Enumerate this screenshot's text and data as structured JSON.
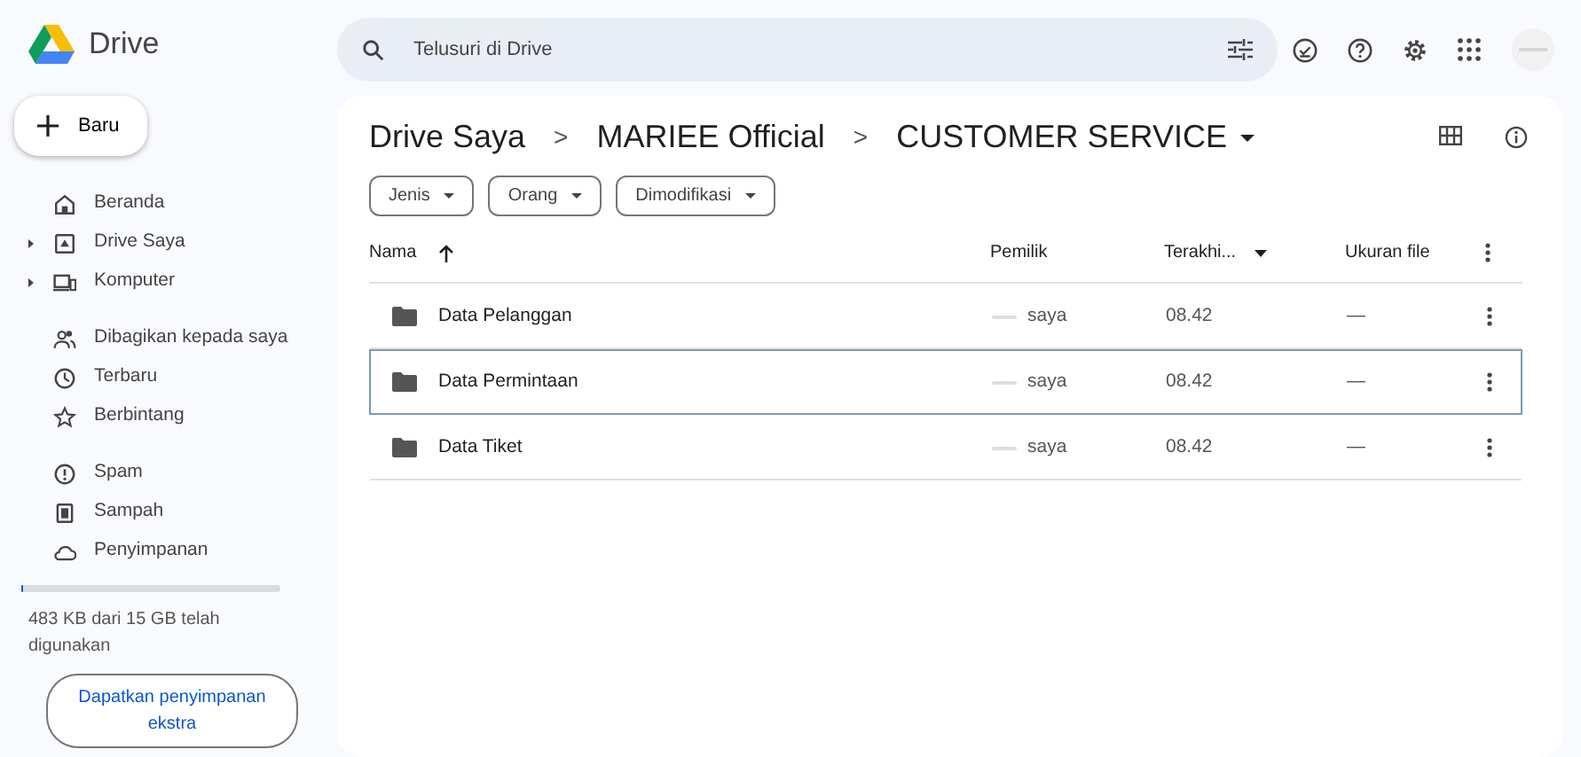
{
  "app": {
    "name": "Drive"
  },
  "search": {
    "placeholder": "Telusuri di Drive"
  },
  "new_button": {
    "label": "Baru"
  },
  "sidebar": {
    "items": [
      {
        "label": "Beranda",
        "kind": "link",
        "selected": false
      },
      {
        "label": "Drive Saya",
        "kind": "tree",
        "selected": false
      },
      {
        "label": "Komputer",
        "kind": "tree",
        "selected": false
      },
      {
        "label": "Dibagikan kepada saya",
        "kind": "link",
        "selected": false
      },
      {
        "label": "Terbaru",
        "kind": "link",
        "selected": false
      },
      {
        "label": "Berbintang",
        "kind": "link",
        "selected": false
      },
      {
        "label": "Spam",
        "kind": "link",
        "selected": false
      },
      {
        "label": "Sampah",
        "kind": "link",
        "selected": false
      },
      {
        "label": "Penyimpanan",
        "kind": "link",
        "selected": false
      }
    ]
  },
  "storage": {
    "level": 0.01,
    "text": "483 KB dari 15 GB telah digunakan",
    "button": "Dapatkan penyimpanan ekstra"
  },
  "breadcrumb": [
    {
      "label": "Drive Saya"
    },
    {
      "label": "MARIEE Official"
    },
    {
      "label": "CUSTOMER SERVICE"
    }
  ],
  "separator": ">",
  "filters": [
    {
      "label": "Jenis"
    },
    {
      "label": "Orang"
    },
    {
      "label": "Dimodifikasi"
    }
  ],
  "table": {
    "columns": [
      "Nama",
      "Pemilik",
      "Terakhi...",
      "Ukuran file"
    ],
    "rows": [
      {
        "name": "Data Pelanggan",
        "owner": "saya",
        "modified": "08.42",
        "size": "—",
        "selected": false
      },
      {
        "name": "Data Permintaan",
        "owner": "saya",
        "modified": "08.42",
        "size": "—",
        "selected": true
      },
      {
        "name": "Data Tiket",
        "owner": "saya",
        "modified": "08.42",
        "size": "—",
        "selected": false
      }
    ]
  }
}
